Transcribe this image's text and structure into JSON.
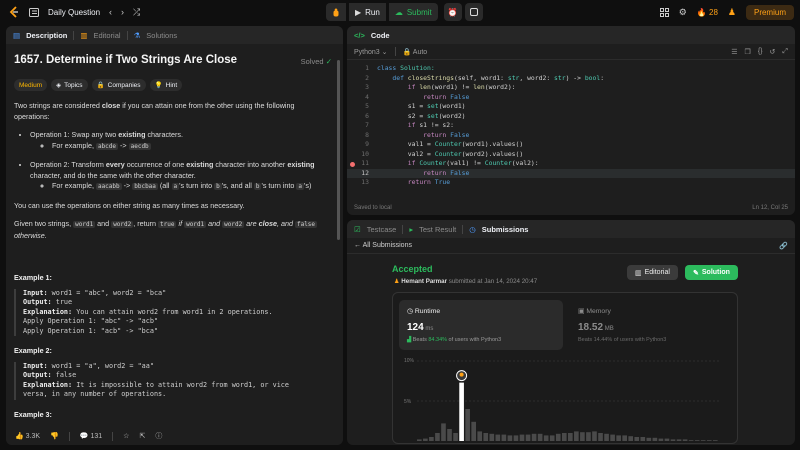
{
  "topbar": {
    "title": "Daily Question",
    "run_label": "Run",
    "submit_label": "Submit",
    "streak": "28",
    "premium_label": "Premium"
  },
  "left_panel": {
    "tabs": [
      "Description",
      "Editorial",
      "Solutions"
    ],
    "problem_title": "1657. Determine if Two Strings Are Close",
    "solved_label": "Solved",
    "tags": [
      "Medium",
      "Topics",
      "Companies",
      "Hint"
    ],
    "intro_a": "Two strings are considered ",
    "intro_b": "close",
    "intro_c": " if you can attain one from the other using the following operations:",
    "op1_a": "Operation 1: Swap any two ",
    "op1_b": "existing",
    "op1_c": " characters.",
    "op1_example_prefix": "For example, ",
    "op1_ex_from": "abcde",
    "op1_ex_arrow": " -> ",
    "op1_ex_to": "aecdb",
    "op2_a": "Operation 2: Transform ",
    "op2_b": "every",
    "op2_c": " occurrence of one ",
    "op2_d": "existing",
    "op2_e": " character into another ",
    "op2_f": "existing",
    "op2_g": " character, and do the same with the other character.",
    "op2_example_prefix": "For example, ",
    "op2_ex_from": "aacabb",
    "op2_ex_arrow": " -> ",
    "op2_ex_to": "bbcbaa",
    "op2_ex_note_a": " (all ",
    "op2_ex_note_b": "a",
    "op2_ex_note_c": "'s turn into ",
    "op2_ex_note_d": "b",
    "op2_ex_note_e": "'s, and all ",
    "op2_ex_note_f": "b",
    "op2_ex_note_g": "'s turn into ",
    "op2_ex_note_h": "a",
    "op2_ex_note_i": "'s)",
    "ops_note": "You can use the operations on either string as many times as necessary.",
    "given_a": "Given two strings, ",
    "given_w1": "word1",
    "given_and": " and ",
    "given_w2": "word2",
    "given_b": ", return ",
    "given_true": "true",
    "given_c": " if ",
    "given_w1b": "word1",
    "given_and2": " and ",
    "given_w2b": "word2",
    "given_d": " are ",
    "given_close": "close",
    "given_e": ", and ",
    "given_false": "false",
    "given_f": " otherwise.",
    "ex1_title": "Example 1:",
    "ex1_input_label": "Input:",
    "ex1_input": " word1 = \"abc\", word2 = \"bca\"",
    "ex1_output_label": "Output:",
    "ex1_output": " true",
    "ex1_expl_label": "Explanation:",
    "ex1_expl": " You can attain word2 from word1 in 2 operations.",
    "ex1_line4": "Apply Operation 1: \"abc\" -> \"acb\"",
    "ex1_line5": "Apply Operation 1: \"acb\" -> \"bca\"",
    "ex2_title": "Example 2:",
    "ex2_input_label": "Input:",
    "ex2_input": " word1 = \"a\", word2 = \"aa\"",
    "ex2_output_label": "Output:",
    "ex2_output": " false",
    "ex2_expl_label": "Explanation:",
    "ex2_expl": " It is impossible to attain word2 from word1, or vice",
    "ex2_line4": "versa, in any number of operations.",
    "ex3_title": "Example 3:",
    "likes": "3.3K",
    "comments": "131"
  },
  "code_panel": {
    "tab_label": "Code",
    "language": "Python3",
    "mode": "Auto",
    "saved": "Saved to local",
    "cursor": "Ln 12, Col 25",
    "lines": [
      {
        "n": "1",
        "hl": false
      },
      {
        "n": "2",
        "hl": false
      },
      {
        "n": "3",
        "hl": false
      },
      {
        "n": "4",
        "hl": false
      },
      {
        "n": "5",
        "hl": false
      },
      {
        "n": "6",
        "hl": false
      },
      {
        "n": "7",
        "hl": false
      },
      {
        "n": "8",
        "hl": false
      },
      {
        "n": "9",
        "hl": false
      },
      {
        "n": "10",
        "hl": false
      },
      {
        "n": "11",
        "hl": false
      },
      {
        "n": "12",
        "hl": true
      },
      {
        "n": "13",
        "hl": false
      }
    ],
    "code": {
      "l1_kw": "class",
      "l1_name": " Solution:",
      "l2_kw": "def",
      "l2_fn": " closeStrings",
      "l2_rest": "(self, word1: ",
      "l2_t1": "str",
      "l2_mid": ", word2: ",
      "l2_t2": "str",
      "l2_end": ") -> ",
      "l2_t3": "bool",
      "l2_colon": ":",
      "l3_kw": "if",
      "l3_fn1": " len",
      "l3_a": "(word1) != ",
      "l3_fn2": "len",
      "l3_b": "(word2):",
      "l4_kw": "return",
      "l4_val": " False",
      "l5_a": "s1 = ",
      "l5_fn": "set",
      "l5_b": "(word1)",
      "l6_a": "s2 = ",
      "l6_fn": "set",
      "l6_b": "(word2)",
      "l7_kw": "if",
      "l7_a": " s1 != s2:",
      "l8_kw": "return",
      "l8_val": " False",
      "l9_a": "val1 = ",
      "l9_fn": "Counter",
      "l9_b": "(word1).values()",
      "l10_a": "val2 = ",
      "l10_fn": "Counter",
      "l10_b": "(word2).values()",
      "l11_kw": "if",
      "l11_fn": " Counter",
      "l11_a": "(val1) != ",
      "l11_fn2": "Counter",
      "l11_b": "(val2):",
      "l12_kw": "return",
      "l12_val": " False",
      "l13_kw": "return",
      "l13_val": " True"
    }
  },
  "bottom_panel": {
    "tabs": [
      "Testcase",
      "Test Result",
      "Submissions"
    ],
    "all_submissions": "All Submissions",
    "status": "Accepted",
    "author": "Hemant Parmar",
    "submitted_at": " submitted at Jan 14, 2024 20:47",
    "editorial_label": "Editorial",
    "solution_label": "Solution",
    "runtime_label": "Runtime",
    "runtime_value": "124",
    "runtime_unit": " ms",
    "runtime_beats_a": "Beats ",
    "runtime_beats_pct": "84.34%",
    "runtime_beats_b": " of users with Python3",
    "memory_label": "Memory",
    "memory_value": "18.52",
    "memory_unit": " MB",
    "memory_beats": "Beats 14.44% of users with Python3"
  },
  "chart_data": {
    "type": "bar",
    "y_ticks": [
      "10%",
      "5%"
    ],
    "ylim": [
      0,
      10
    ],
    "values": [
      0.2,
      0.3,
      0.5,
      1.0,
      2.2,
      1.5,
      1.0,
      7.3,
      4.0,
      2.4,
      1.2,
      1.0,
      0.9,
      0.8,
      0.8,
      0.7,
      0.7,
      0.8,
      0.8,
      0.9,
      0.9,
      0.7,
      0.7,
      0.9,
      1.0,
      1.0,
      1.2,
      1.1,
      1.1,
      1.2,
      1.0,
      0.9,
      0.8,
      0.7,
      0.7,
      0.6,
      0.5,
      0.5,
      0.4,
      0.4,
      0.3,
      0.3,
      0.2,
      0.2,
      0.2,
      0.1,
      0.1,
      0.1,
      0.1,
      0.1
    ],
    "highlight_index": 7,
    "colors": {
      "bar": "#4a4a4a",
      "highlight": "#ffffff"
    }
  }
}
